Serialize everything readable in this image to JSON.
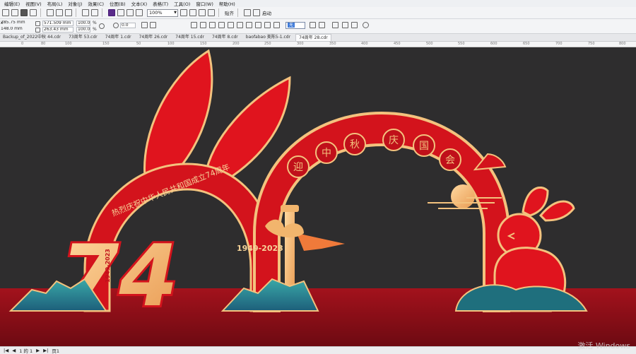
{
  "menu": [
    "编辑(E)",
    "视图(V)",
    "布局(L)",
    "对象(J)",
    "效果(C)",
    "位图(B)",
    "文本(X)",
    "表格(T)",
    "工具(O)",
    "窗口(W)",
    "帮助(H)"
  ],
  "toolbar": {
    "zoom_value": "100%",
    "snap_label": "贴齐",
    "launch_label": "启动"
  },
  "properties": {
    "pos_x": "285.75 mm",
    "pos_y": "148.0 mm",
    "width": "571.509 mm",
    "height": "263.43 mm",
    "scale_x": "100.0",
    "scale_y": "100.0",
    "scale_unit": "%",
    "rotation": "0.0",
    "outline_preset": "无"
  },
  "tabs": [
    "Backup_of_2022中秋 44.cdr",
    "73周年 53.cdr",
    "74周年 1.cdr",
    "74周年 26.cdr",
    "74周年 15.cdr",
    "74周年 8.cdr",
    "baofabao 美陈5-1.cdr",
    "74周年 28.cdr"
  ],
  "active_tab": 7,
  "ruler_ticks": [
    "0",
    "80",
    "100",
    "150",
    "50",
    "100",
    "150",
    "200",
    "250",
    "300",
    "350",
    "400",
    "450",
    "500",
    "550",
    "600",
    "650",
    "700",
    "750",
    "800"
  ],
  "artwork": {
    "banner_text": "热烈庆祝中华人民共和国成立74周年",
    "big_number": "74",
    "number_years": "1949-2023",
    "years_label": "1949-2023",
    "mid_autumn_chars": [
      "迎",
      "中",
      "秋",
      "庆",
      "国",
      "会"
    ]
  },
  "status": {
    "page_counter": "1 的 1",
    "page_label": "页1"
  },
  "watermark": "激活 Windows",
  "colors": {
    "canvas_bg": "#2e2d2e",
    "ground": "#8e0f18",
    "arch_red": "#d3131c",
    "gold": "#f3c27e",
    "teal": "#2b8c92"
  }
}
